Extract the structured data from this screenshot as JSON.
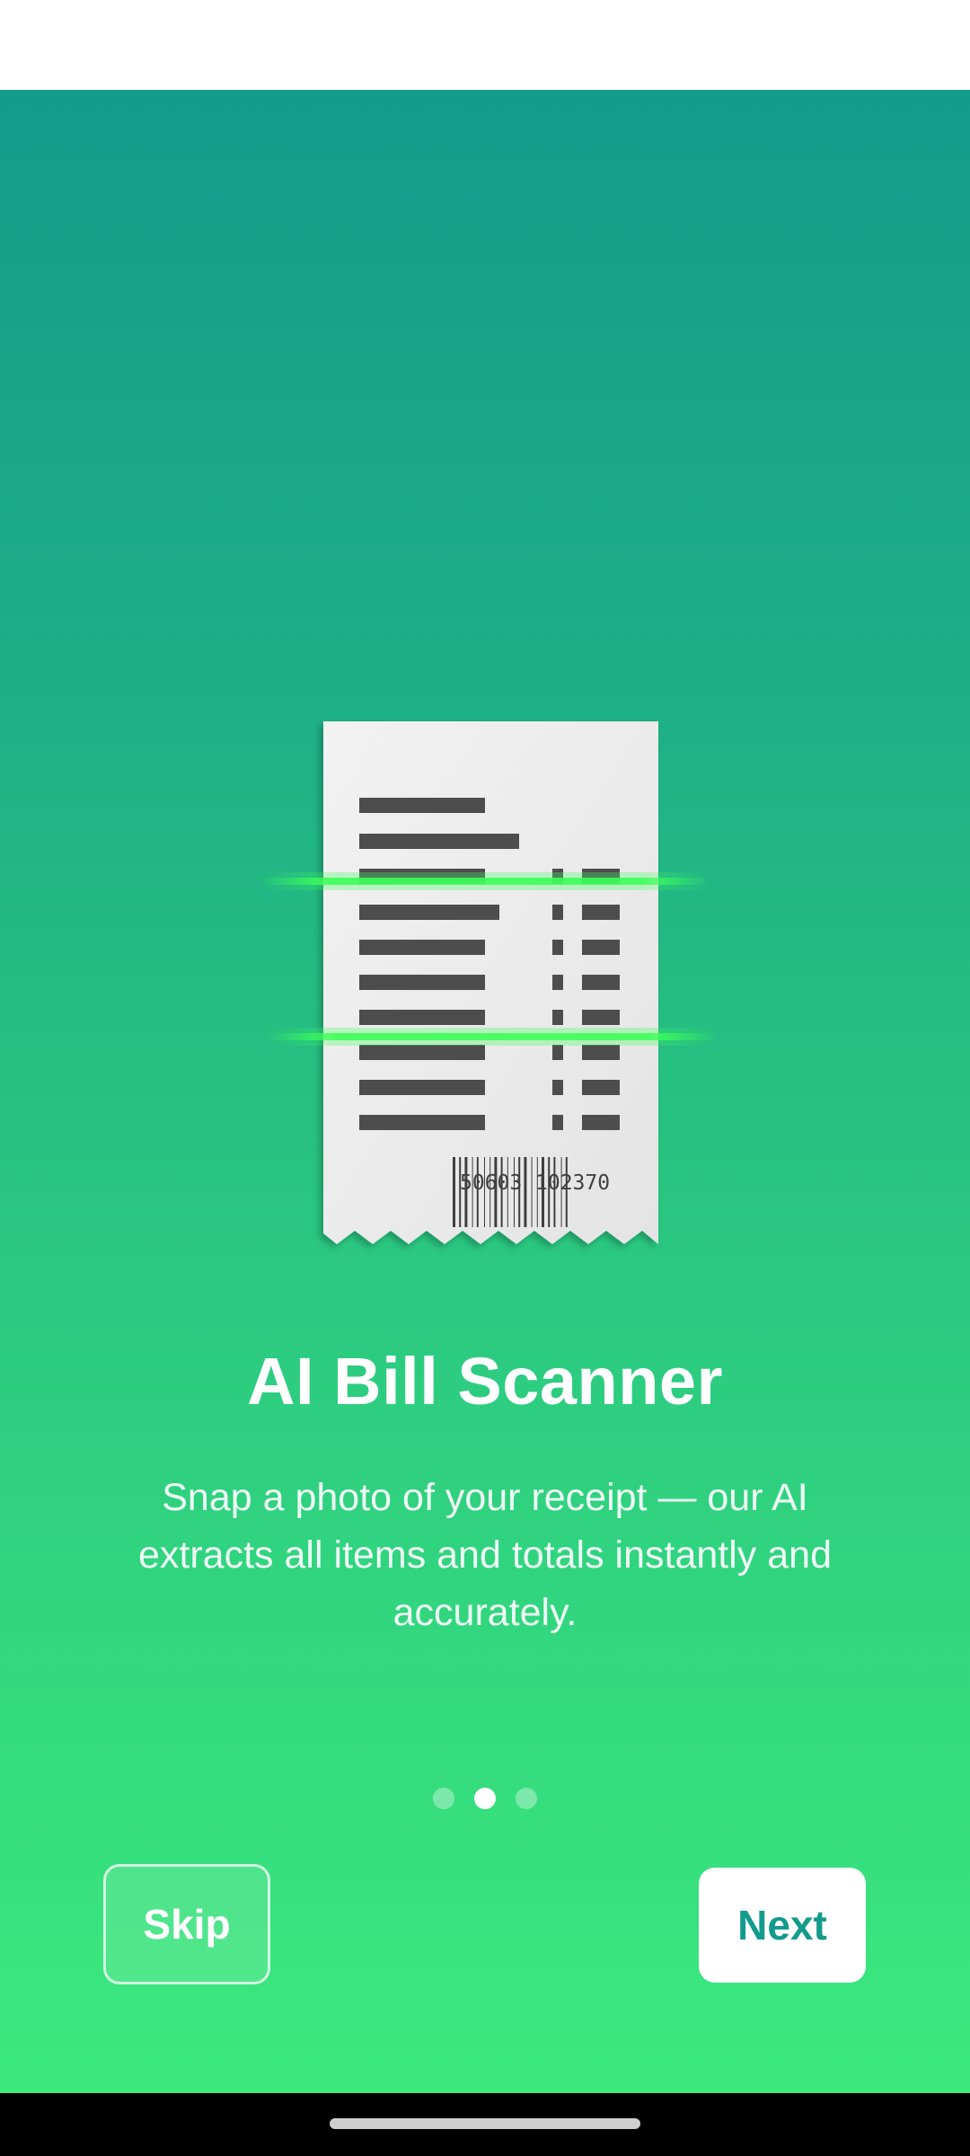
{
  "onboarding": {
    "title": "AI Bill Scanner",
    "description": "Snap a photo of your receipt — our AI extracts all items and totals instantly and accurately.",
    "receipt_barcode_left": "50603",
    "receipt_barcode_right": "102370",
    "page_indicator": {
      "total": 3,
      "current": 2
    },
    "skip_label": "Skip",
    "next_label": "Next"
  },
  "colors": {
    "gradient_top": "#139b8c",
    "gradient_bottom": "#3ce97d",
    "accent": "#139b8c",
    "scan_line": "#3dff5a"
  }
}
